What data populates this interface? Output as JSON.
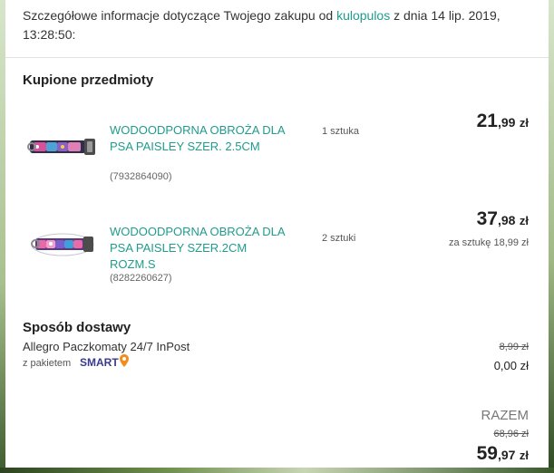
{
  "intro": {
    "text_before": "Szczegółowe informacje dotyczące Twojego zakupu od ",
    "seller": "kulopulos",
    "text_after": " z dnia 14 lip. 2019, 13:28:50:"
  },
  "purchased": {
    "title": "Kupione przedmioty",
    "items": [
      {
        "name": "WODOODPORNA OBROŻA DLA PSA PAISLEY SZER. 2.5CM",
        "id": "(7932864090)",
        "quantity": "1 sztuka",
        "price_int": "21",
        "price_dec": ",99",
        "currency": "zł",
        "unit_price": ""
      },
      {
        "name": "WODOODPORNA OBROŻA DLA PSA PAISLEY SZER.2CM ROZM.S",
        "id": "(8282260627)",
        "quantity": "2 sztuki",
        "price_int": "37",
        "price_dec": ",98",
        "currency": "zł",
        "unit_price": "za sztukę 18,99 zł"
      }
    ]
  },
  "delivery": {
    "title": "Sposób dostawy",
    "method": "Allegro Paczkomaty 24/7 InPost",
    "package_label": "z pakietem",
    "package_name": "SMART",
    "old_price": "8,99 zł",
    "price": "0,00 zł"
  },
  "summary": {
    "label": "RAZEM",
    "old_total": "68,96 zł",
    "total_int": "59",
    "total_dec": ",97",
    "currency": "zł"
  },
  "colors": {
    "accent_link": "#1f9c8c",
    "smart_logo": "#3a3a8c",
    "smart_pin": "#f28c1e"
  }
}
